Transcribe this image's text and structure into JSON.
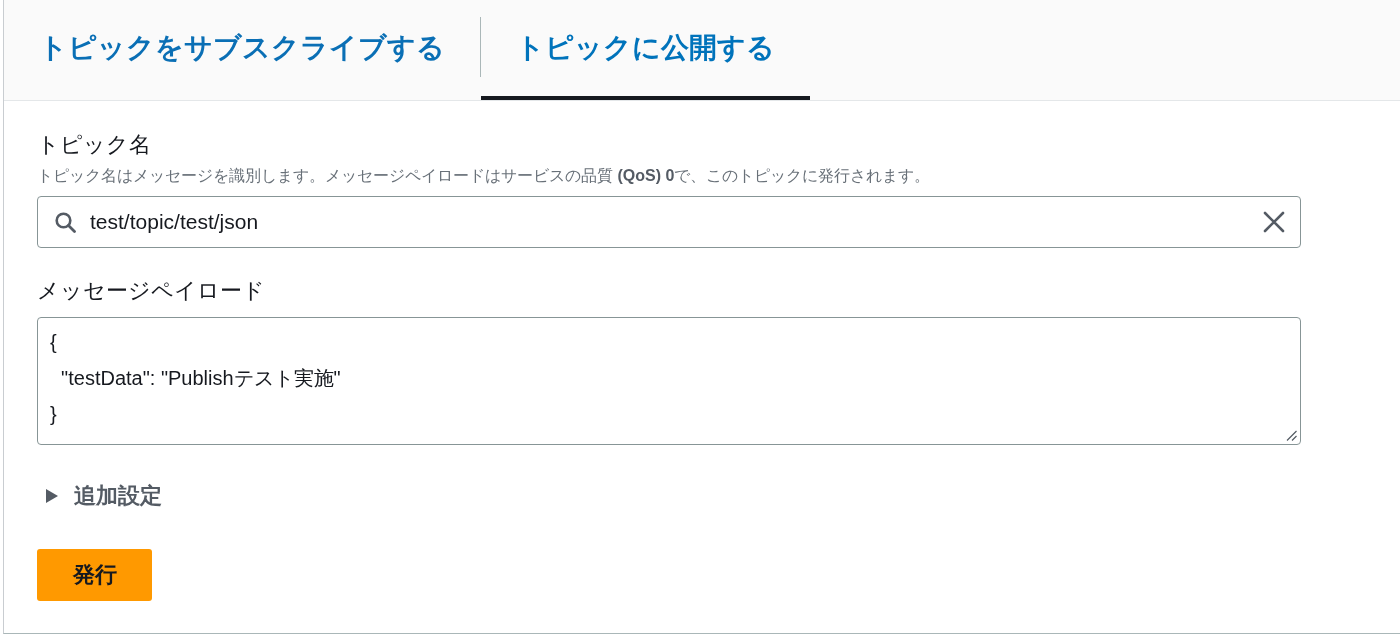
{
  "tabs": [
    {
      "label": "トピックをサブスクライブする",
      "selected": false
    },
    {
      "label": "トピックに公開する",
      "selected": true
    }
  ],
  "topic_name": {
    "label": "トピック名",
    "description": "トピック名はメッセージを識別します。メッセージペイロードはサービスの品質 **(QoS) 0**で、このトピックに発行されます。",
    "value": "test/topic/test/json"
  },
  "message_payload": {
    "label": "メッセージペイロード",
    "lines": [
      "{",
      "  \"testData\": \"Publishテスト実施\"",
      "}"
    ]
  },
  "additional_settings": {
    "label": "追加設定",
    "expanded": false
  },
  "publish_button": {
    "label": "発行"
  }
}
